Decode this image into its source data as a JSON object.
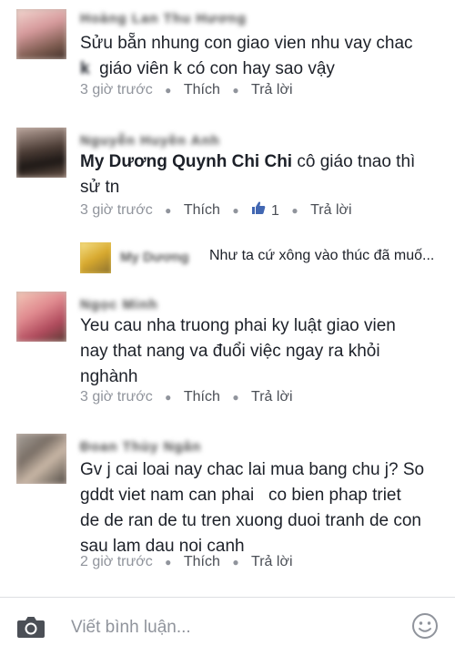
{
  "comments": [
    {
      "author": "Hoàng Lan Thu Hương",
      "text_line1": "Sửu bẵn nhung con giao vien nhu vay chac",
      "text_line2_prefix": "k",
      "text_line2": "giáo viên k có con hay sao vậy",
      "time": "3 giờ trước",
      "like_label": "Thích",
      "reply_label": "Trả lời"
    },
    {
      "author": "Nguyễn Huyền Anh",
      "mention": "My Dương Quynh Chi Chi",
      "text_after_mention": " cô giáo tnao thì",
      "text_line2": "sử tn",
      "time": "3 giờ trước",
      "like_label": "Thích",
      "like_count": "1",
      "reply_label": "Trả lời",
      "reply": {
        "author": "My Dương",
        "text": "Như ta cứ xông vào thúc đã muố..."
      }
    },
    {
      "author": "Ngọc Minh",
      "text_line1": "Yeu cau nha truong phai ky luật giao vien",
      "text_line2": "nay that nang va đuổi việc ngay ra khỏi",
      "text_line3": "nghành",
      "time": "3 giờ trước",
      "like_label": "Thích",
      "reply_label": "Trả lời"
    },
    {
      "author": "Đoan Thùy Ngân",
      "text_line1": "Gv j cai loai nay chac lai mua bang chu j? So",
      "text_line2": "gddt viet nam can phai   co bien phap triet",
      "text_line3": "de de ran de tu tren xuong duoi tranh de con",
      "text_line4": "sau lam dau noi canh",
      "time": "2 giờ trước",
      "like_label": "Thích",
      "reply_label": "Trả lời"
    }
  ],
  "composer": {
    "placeholder": "Viết bình luận...",
    "camera_icon": "camera-icon",
    "emoji_icon": "smiley-icon"
  },
  "colors": {
    "text": "#1d2129",
    "meta": "#90949c",
    "link": "#4b4f56",
    "border": "#dddfe2"
  }
}
